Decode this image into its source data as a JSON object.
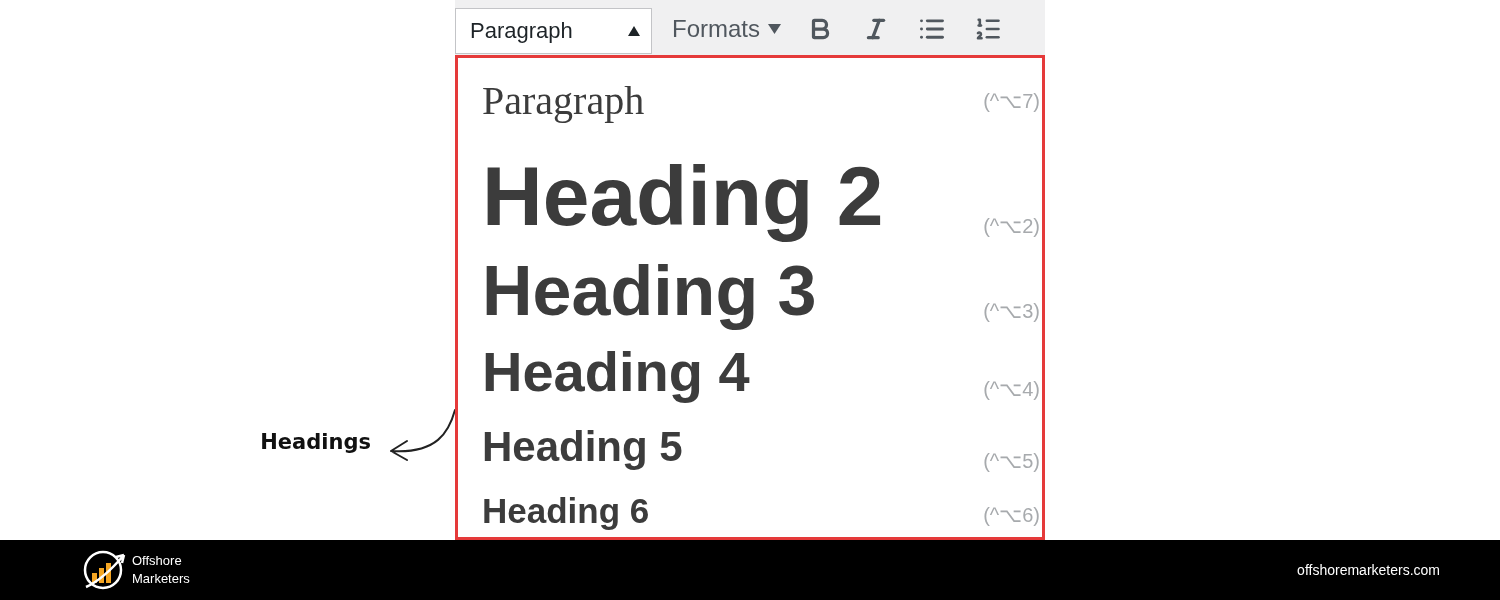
{
  "annotation": {
    "label": "Headings"
  },
  "toolbar": {
    "block_format": {
      "value": "Paragraph",
      "expanded": true
    },
    "formats": {
      "label": "Formats"
    }
  },
  "dropdown": {
    "items": [
      {
        "kind": "paragraph",
        "label": "Paragraph",
        "shortcut": "(^⌥7)"
      },
      {
        "kind": "h2",
        "label": "Heading 2",
        "shortcut": "(^⌥2)"
      },
      {
        "kind": "h3",
        "label": "Heading 3",
        "shortcut": "(^⌥3)"
      },
      {
        "kind": "h4",
        "label": "Heading 4",
        "shortcut": "(^⌥4)"
      },
      {
        "kind": "h5",
        "label": "Heading 5",
        "shortcut": "(^⌥5)"
      },
      {
        "kind": "h6",
        "label": "Heading 6",
        "shortcut": "(^⌥6)"
      }
    ]
  },
  "footer": {
    "brand": "Offshore Marketers",
    "website": "offshoremarketers.com"
  }
}
